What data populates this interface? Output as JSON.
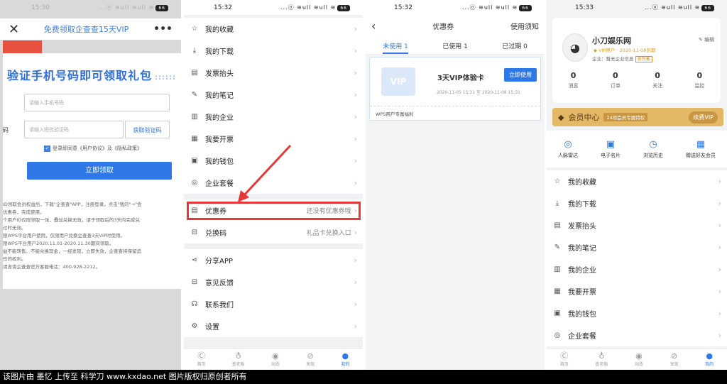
{
  "status_times": [
    "15:30",
    "15:32",
    "15:32",
    "15:33"
  ],
  "status_icons": "...ⓞ ≋ull ≋ull ≋",
  "battery": "66",
  "p1": {
    "close": "✕",
    "header_title": "免费领取企查查15天VIP",
    "menu_dots": "•••",
    "title": "验证手机号码即可领取礼包",
    "title_deco": "::::::",
    "phone_placeholder": "请输入手机号码",
    "code_label": "码",
    "code_placeholder": "请输入短信验证码",
    "get_code": "获取验证码",
    "agree_text": "登录即同意《用户协议》及《隐私政策》",
    "submit": "立即领取",
    "rules": [
      "ID领取会员权益后，下载\"企查查\"APP，注册登录，点击\"我的\"→\"会",
      "优惠券，完成使用。",
      "个用户ID仅限领取一张，叠加兑换无效，请于领取后的3天内完成兑",
      "过时无效。",
      "限WPS平台用户使用，仅限用户兑换企查查3天VIP时使用。",
      "限WPS平台用户2020.11.01-2020.11.30期间领取。",
      "益不能转售、不能兑换现金，一经发现，立即失效，企查查将保留追",
      "任的权利。",
      "请咨询企查查官方客服电话：400-928-2212。"
    ]
  },
  "menu_items": [
    {
      "icon": "☆",
      "label": "我的收藏"
    },
    {
      "icon": "⤓",
      "label": "我的下载"
    },
    {
      "icon": "▤",
      "label": "发票抬头"
    },
    {
      "icon": "✎",
      "label": "我的笔记"
    },
    {
      "icon": "▥",
      "label": "我的企业"
    },
    {
      "icon": "▦",
      "label": "我要开票"
    },
    {
      "icon": "▣",
      "label": "我的钱包"
    },
    {
      "icon": "◎",
      "label": "企业套餐"
    }
  ],
  "p2": {
    "coupon": {
      "icon": "▤",
      "label": "优惠券",
      "sub": "还没有优惠券哦"
    },
    "redeem": {
      "icon": "⊟",
      "label": "兑换码",
      "sub": "礼品卡兑换入口"
    },
    "share": {
      "icon": "⋖",
      "label": "分享APP"
    },
    "feedback": {
      "icon": "⊟",
      "label": "意见反馈"
    },
    "contact": {
      "icon": "☊",
      "label": "联系我们"
    },
    "settings": {
      "icon": "⚙",
      "label": "设置"
    }
  },
  "tabbar": [
    {
      "icon": "Ⓒ",
      "label": "首页"
    },
    {
      "icon": "♁",
      "label": "查老板"
    },
    {
      "icon": "◉",
      "label": "动态"
    },
    {
      "icon": "⊘",
      "label": "发现"
    },
    {
      "icon": "●",
      "label": "我的"
    }
  ],
  "p3": {
    "back": "‹",
    "title": "优惠券",
    "notice": "使用须知",
    "tabs": [
      "未使用 1",
      "已使用 1",
      "已过期 0"
    ],
    "card_name": "3天VIP体验卡",
    "card_date": "2020-11-05 15:31 至 2020-11-08 15:31",
    "use_now": "立即使用",
    "card_foot": "WPS用户专属福利",
    "vip_img": "VIP"
  },
  "p4": {
    "avatar": "◕",
    "name": "小刀娱乐网",
    "vip": "◆ VIP用户 · 2020-11-08到期",
    "company": "企业：暂无企业信息",
    "company_tag": "去完善",
    "edit": "✎ 编辑",
    "stats": [
      {
        "n": "0",
        "l": "消息"
      },
      {
        "n": "0",
        "l": "订单"
      },
      {
        "n": "0",
        "l": "关注"
      },
      {
        "n": "0",
        "l": "监控"
      }
    ],
    "member_center": "会员中心",
    "member_tag": "24项会员专属特权",
    "renew": "续费VIP",
    "quick": [
      {
        "icon": "◎",
        "label": "人脉雷达"
      },
      {
        "icon": "▣",
        "label": "电子名片"
      },
      {
        "icon": "◷",
        "label": "浏览历史"
      },
      {
        "icon": "▦",
        "label": "赠送好友会员"
      }
    ]
  },
  "footer": "该图片由 墨忆 上传至 科学刀 www.kxdao.net 图片版权归原创者所有",
  "colors": {
    "accent": "#2f78e8",
    "highlight": "#e53935"
  }
}
